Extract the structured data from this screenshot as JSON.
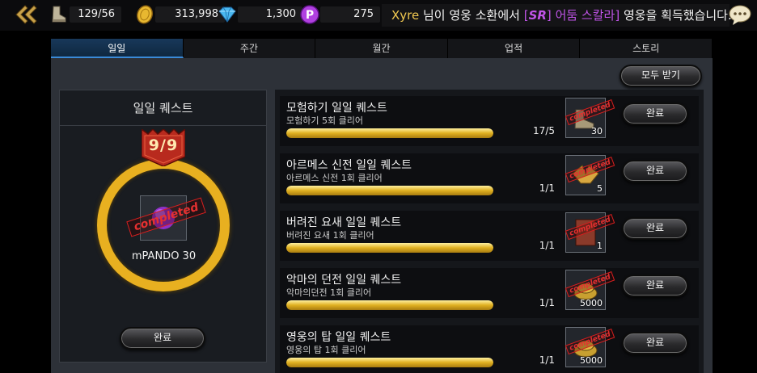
{
  "topbar": {
    "resources": [
      {
        "name": "stamina",
        "icon": "boot-icon",
        "value": "129/56"
      },
      {
        "name": "gold",
        "icon": "coin-icon",
        "value": "313,998"
      },
      {
        "name": "gems",
        "icon": "diamond-icon",
        "value": "1,300"
      },
      {
        "name": "pando",
        "icon": "p-coin-icon",
        "value": "275"
      }
    ],
    "notice": {
      "user": "Xyre",
      "text1": " 님이 영웅 소환에서 ",
      "grade": "SR",
      "hero": "어둠 스칼라",
      "text2": " 영웅을 획득했습니다."
    }
  },
  "tabs": [
    "일일",
    "주간",
    "월간",
    "업적",
    "스토리"
  ],
  "receive_all_label": "모두 받기",
  "daily": {
    "title": "일일 퀘스트",
    "progress_text": "9/9",
    "stamp": "completed",
    "reward": "mPANDO 30",
    "complete_label": "완료"
  },
  "quests": [
    {
      "title": "모험하기 일일 퀘스트",
      "desc": "모험하기 5회 클리어",
      "count": "17/5",
      "progress": 1.0,
      "reward_qty": "30",
      "reward_icon": "shoe-icon",
      "stamp": "completed",
      "button": "완료"
    },
    {
      "title": "아르메스 신전 일일 퀘스트",
      "desc": "아르메스 신전 1회 클리어",
      "count": "1/1",
      "progress": 1.0,
      "reward_qty": "5",
      "reward_icon": "wing-scroll-icon",
      "stamp": "completed",
      "button": "완료"
    },
    {
      "title": "버려진 요새 일일 퀘스트",
      "desc": "버려진 요새 1회 클리어",
      "count": "1/1",
      "progress": 1.0,
      "reward_qty": "1",
      "reward_icon": "scroll-icon",
      "stamp": "completed",
      "button": "완료"
    },
    {
      "title": "악마의 던전 일일 퀘스트",
      "desc": "악마의던전 1회 클리어",
      "count": "1/1",
      "progress": 1.0,
      "reward_qty": "5000",
      "reward_icon": "coin-pile-icon",
      "stamp": "completed",
      "button": "완료"
    },
    {
      "title": "영웅의 탑 일일 퀘스트",
      "desc": "영웅의 탑 1회 클리어",
      "count": "1/1",
      "progress": 1.0,
      "reward_qty": "5000",
      "reward_icon": "coin-pile-icon",
      "stamp": "completed",
      "button": "완료"
    }
  ],
  "colors": {
    "gold": "#e8b020",
    "stamp": "#e63030",
    "tab_active": "#1a3a5c",
    "panel": "#2d3138"
  }
}
